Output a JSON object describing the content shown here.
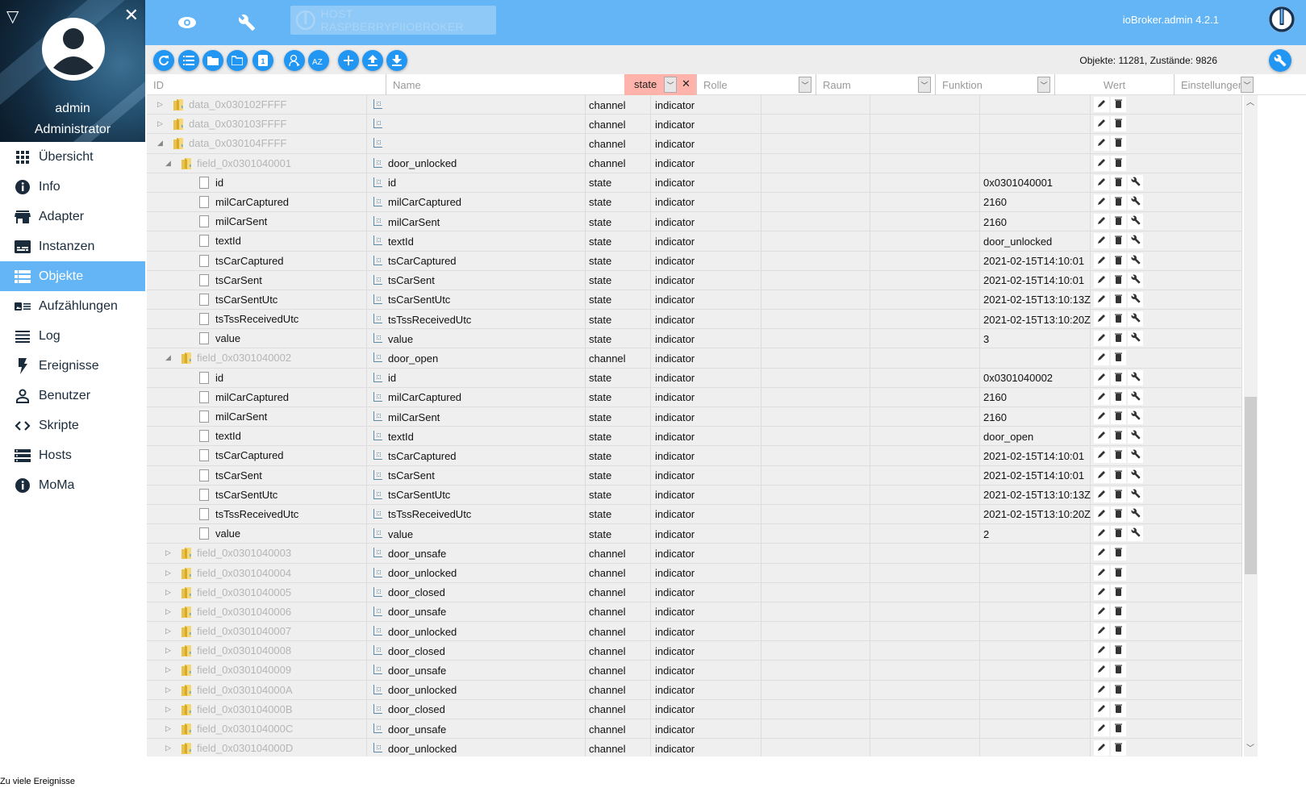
{
  "sidebar": {
    "user_name": "admin",
    "user_role": "Administrator",
    "items": [
      {
        "label": "Übersicht",
        "icon": "apps-icon",
        "active": false
      },
      {
        "label": "Info",
        "icon": "info-icon",
        "active": false
      },
      {
        "label": "Adapter",
        "icon": "store-icon",
        "active": false
      },
      {
        "label": "Instanzen",
        "icon": "subtitles-icon",
        "active": false
      },
      {
        "label": "Objekte",
        "icon": "list-icon",
        "active": true
      },
      {
        "label": "Aufzählungen",
        "icon": "enum-icon",
        "active": false
      },
      {
        "label": "Log",
        "icon": "menu-lines-icon",
        "active": false
      },
      {
        "label": "Ereignisse",
        "icon": "flash-icon",
        "active": false
      },
      {
        "label": "Benutzer",
        "icon": "person-icon",
        "active": false
      },
      {
        "label": "Skripte",
        "icon": "code-icon",
        "active": false
      },
      {
        "label": "Hosts",
        "icon": "storage-icon",
        "active": false
      },
      {
        "label": "MoMa",
        "icon": "info-icon",
        "active": false
      }
    ]
  },
  "topbar": {
    "host_label": "HOST RASPBERRYPIIOBROKER",
    "app_version": "ioBroker.admin 4.2.1"
  },
  "toolbar": {
    "buttons": [
      "refresh-icon",
      "list-icon",
      "folder-icon",
      "folder-open-icon",
      "counter-icon",
      "expert-mode-icon",
      "sort-az-icon",
      "add-icon",
      "upload-icon",
      "download-icon"
    ],
    "counts_text": "Objekte: 11281, Zustände: 9826"
  },
  "header": {
    "id_placeholder": "ID",
    "name_placeholder": "Name",
    "type_filter": "state",
    "role_placeholder": "Rolle",
    "room_placeholder": "Raum",
    "function_placeholder": "Funktion",
    "value_label": "Wert",
    "settings_label": "Einstellungen"
  },
  "rows": [
    {
      "level": 0,
      "kind": "folder",
      "toggle": "collapsed",
      "id": "data_0x030102FFFF",
      "name": "",
      "type": "channel",
      "role": "indicator",
      "value": "",
      "wrench": false
    },
    {
      "level": 0,
      "kind": "folder",
      "toggle": "collapsed",
      "id": "data_0x030103FFFF",
      "name": "",
      "type": "channel",
      "role": "indicator",
      "value": "",
      "wrench": false
    },
    {
      "level": 0,
      "kind": "folder",
      "toggle": "expanded",
      "id": "data_0x030104FFFF",
      "name": "",
      "type": "channel",
      "role": "indicator",
      "value": "",
      "wrench": false
    },
    {
      "level": 1,
      "kind": "folder",
      "toggle": "expanded",
      "id": "field_0x0301040001",
      "name": "door_unlocked",
      "type": "channel",
      "role": "indicator",
      "value": "",
      "wrench": false
    },
    {
      "level": 2,
      "kind": "state",
      "id": "id",
      "name": "id",
      "type": "state",
      "role": "indicator",
      "value": "0x0301040001",
      "wrench": true
    },
    {
      "level": 2,
      "kind": "state",
      "id": "milCarCaptured",
      "name": "milCarCaptured",
      "type": "state",
      "role": "indicator",
      "value": "2160",
      "wrench": true
    },
    {
      "level": 2,
      "kind": "state",
      "id": "milCarSent",
      "name": "milCarSent",
      "type": "state",
      "role": "indicator",
      "value": "2160",
      "wrench": true
    },
    {
      "level": 2,
      "kind": "state",
      "id": "textId",
      "name": "textId",
      "type": "state",
      "role": "indicator",
      "value": "door_unlocked",
      "wrench": true
    },
    {
      "level": 2,
      "kind": "state",
      "id": "tsCarCaptured",
      "name": "tsCarCaptured",
      "type": "state",
      "role": "indicator",
      "value": "2021-02-15T14:10:01",
      "wrench": true
    },
    {
      "level": 2,
      "kind": "state",
      "id": "tsCarSent",
      "name": "tsCarSent",
      "type": "state",
      "role": "indicator",
      "value": "2021-02-15T14:10:01",
      "wrench": true
    },
    {
      "level": 2,
      "kind": "state",
      "id": "tsCarSentUtc",
      "name": "tsCarSentUtc",
      "type": "state",
      "role": "indicator",
      "value": "2021-02-15T13:10:13Z",
      "wrench": true
    },
    {
      "level": 2,
      "kind": "state",
      "id": "tsTssReceivedUtc",
      "name": "tsTssReceivedUtc",
      "type": "state",
      "role": "indicator",
      "value": "2021-02-15T13:10:20Z",
      "wrench": true
    },
    {
      "level": 2,
      "kind": "state",
      "id": "value",
      "name": "value",
      "type": "state",
      "role": "indicator",
      "value": "3",
      "wrench": true
    },
    {
      "level": 1,
      "kind": "folder",
      "toggle": "expanded",
      "id": "field_0x0301040002",
      "name": "door_open",
      "type": "channel",
      "role": "indicator",
      "value": "",
      "wrench": false
    },
    {
      "level": 2,
      "kind": "state",
      "id": "id",
      "name": "id",
      "type": "state",
      "role": "indicator",
      "value": "0x0301040002",
      "wrench": true
    },
    {
      "level": 2,
      "kind": "state",
      "id": "milCarCaptured",
      "name": "milCarCaptured",
      "type": "state",
      "role": "indicator",
      "value": "2160",
      "wrench": true
    },
    {
      "level": 2,
      "kind": "state",
      "id": "milCarSent",
      "name": "milCarSent",
      "type": "state",
      "role": "indicator",
      "value": "2160",
      "wrench": true
    },
    {
      "level": 2,
      "kind": "state",
      "id": "textId",
      "name": "textId",
      "type": "state",
      "role": "indicator",
      "value": "door_open",
      "wrench": true
    },
    {
      "level": 2,
      "kind": "state",
      "id": "tsCarCaptured",
      "name": "tsCarCaptured",
      "type": "state",
      "role": "indicator",
      "value": "2021-02-15T14:10:01",
      "wrench": true
    },
    {
      "level": 2,
      "kind": "state",
      "id": "tsCarSent",
      "name": "tsCarSent",
      "type": "state",
      "role": "indicator",
      "value": "2021-02-15T14:10:01",
      "wrench": true
    },
    {
      "level": 2,
      "kind": "state",
      "id": "tsCarSentUtc",
      "name": "tsCarSentUtc",
      "type": "state",
      "role": "indicator",
      "value": "2021-02-15T13:10:13Z",
      "wrench": true
    },
    {
      "level": 2,
      "kind": "state",
      "id": "tsTssReceivedUtc",
      "name": "tsTssReceivedUtc",
      "type": "state",
      "role": "indicator",
      "value": "2021-02-15T13:10:20Z",
      "wrench": true
    },
    {
      "level": 2,
      "kind": "state",
      "id": "value",
      "name": "value",
      "type": "state",
      "role": "indicator",
      "value": "2",
      "wrench": true
    },
    {
      "level": 1,
      "kind": "folder",
      "toggle": "collapsed",
      "id": "field_0x0301040003",
      "name": "door_unsafe",
      "type": "channel",
      "role": "indicator",
      "value": "",
      "wrench": false
    },
    {
      "level": 1,
      "kind": "folder",
      "toggle": "collapsed",
      "id": "field_0x0301040004",
      "name": "door_unlocked",
      "type": "channel",
      "role": "indicator",
      "value": "",
      "wrench": false
    },
    {
      "level": 1,
      "kind": "folder",
      "toggle": "collapsed",
      "id": "field_0x0301040005",
      "name": "door_closed",
      "type": "channel",
      "role": "indicator",
      "value": "",
      "wrench": false
    },
    {
      "level": 1,
      "kind": "folder",
      "toggle": "collapsed",
      "id": "field_0x0301040006",
      "name": "door_unsafe",
      "type": "channel",
      "role": "indicator",
      "value": "",
      "wrench": false
    },
    {
      "level": 1,
      "kind": "folder",
      "toggle": "collapsed",
      "id": "field_0x0301040007",
      "name": "door_unlocked",
      "type": "channel",
      "role": "indicator",
      "value": "",
      "wrench": false
    },
    {
      "level": 1,
      "kind": "folder",
      "toggle": "collapsed",
      "id": "field_0x0301040008",
      "name": "door_closed",
      "type": "channel",
      "role": "indicator",
      "value": "",
      "wrench": false
    },
    {
      "level": 1,
      "kind": "folder",
      "toggle": "collapsed",
      "id": "field_0x0301040009",
      "name": "door_unsafe",
      "type": "channel",
      "role": "indicator",
      "value": "",
      "wrench": false
    },
    {
      "level": 1,
      "kind": "folder",
      "toggle": "collapsed",
      "id": "field_0x030104000A",
      "name": "door_unlocked",
      "type": "channel",
      "role": "indicator",
      "value": "",
      "wrench": false
    },
    {
      "level": 1,
      "kind": "folder",
      "toggle": "collapsed",
      "id": "field_0x030104000B",
      "name": "door_closed",
      "type": "channel",
      "role": "indicator",
      "value": "",
      "wrench": false
    },
    {
      "level": 1,
      "kind": "folder",
      "toggle": "collapsed",
      "id": "field_0x030104000C",
      "name": "door_unsafe",
      "type": "channel",
      "role": "indicator",
      "value": "",
      "wrench": false
    },
    {
      "level": 1,
      "kind": "folder",
      "toggle": "collapsed",
      "id": "field_0x030104000D",
      "name": "door_unlocked",
      "type": "channel",
      "role": "indicator",
      "value": "",
      "wrench": false
    }
  ],
  "status_bar": "Zu viele Ereignisse",
  "colors": {
    "accent": "#64b5f6",
    "button_blue": "#2196f3",
    "filter_active": "#ffb3ab"
  }
}
